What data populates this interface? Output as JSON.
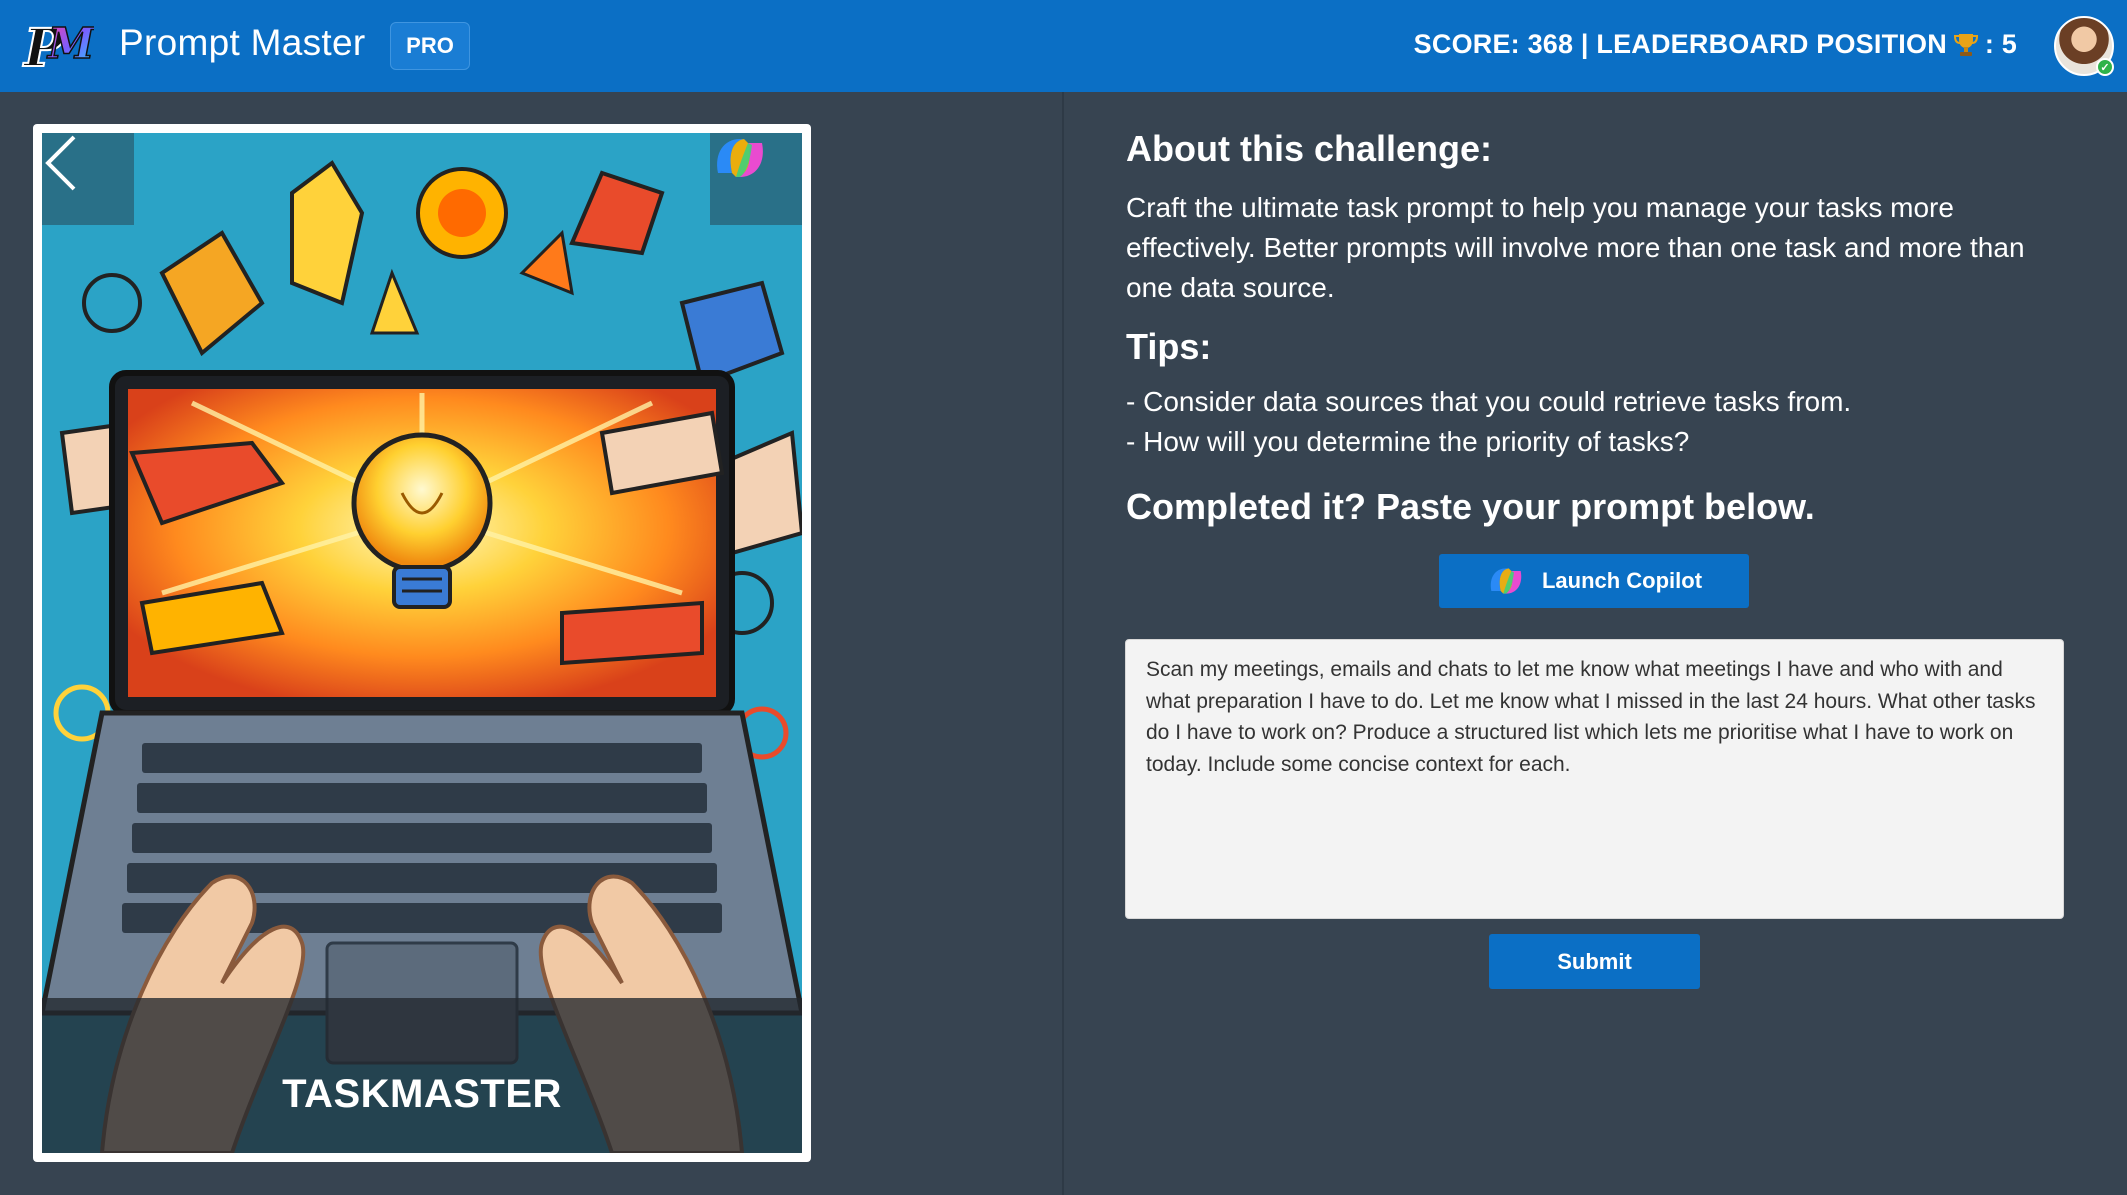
{
  "header": {
    "app_title": "Prompt Master",
    "badge": "PRO",
    "score_text": "SCORE: 368 | LEADERBOARD POSITION",
    "position_text": ": 5",
    "brand_color": "#0b6fc5",
    "logo_icon": "pm-logo-icon",
    "trophy_icon": "trophy-icon",
    "avatar_icon": "user-avatar",
    "presence_status": "available"
  },
  "card": {
    "caption": "TASKMASTER",
    "back_icon": "chevron-left-icon",
    "corner_icon": "copilot-icon",
    "illustration": "laptop-lightbulb-hands-illustration"
  },
  "challenge": {
    "about_heading": "About this challenge:",
    "about_text": "Craft the ultimate task prompt to help you manage your tasks more effectively. Better prompts will involve more than one task and more than one data source.",
    "tips_heading": "Tips:",
    "tips": [
      "- Consider data sources that you could retrieve tasks from.",
      "- How will you determine the priority of tasks?"
    ],
    "complete_heading": "Completed it? Paste your prompt below."
  },
  "actions": {
    "launch_label": "Launch Copilot",
    "launch_icon": "copilot-icon",
    "prompt_value": "Scan my meetings, emails and chats to let me know what meetings I have and who with and what preparation I have to do. Let me know what I missed in the last 24 hours. What other tasks do I have to work on? Produce a structured list which lets me prioritise what I have to work on today. Include some concise context for each.",
    "submit_label": "Submit"
  },
  "colors": {
    "background": "#374451",
    "button": "#0b6fc5",
    "text_box": "#f3f3f3"
  }
}
